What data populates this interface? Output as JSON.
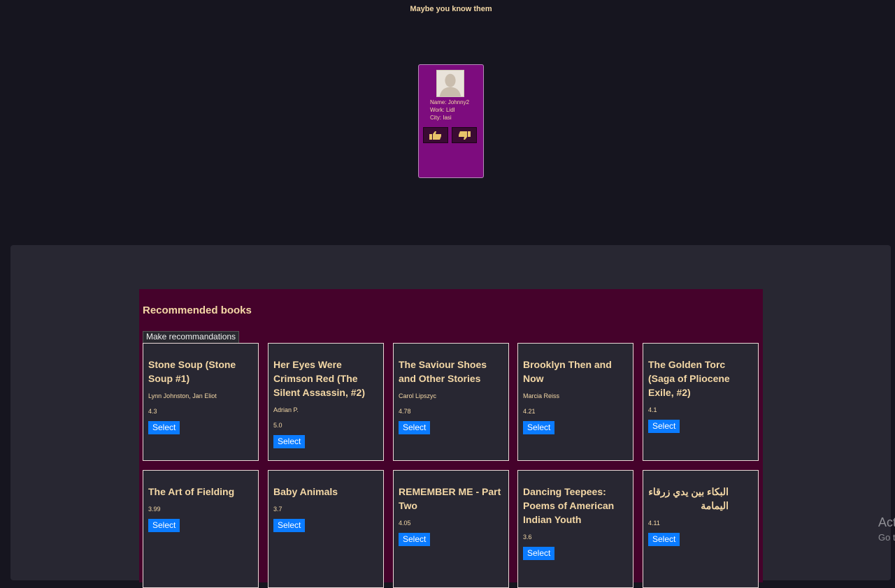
{
  "people_section": {
    "heading": "Maybe you know them",
    "person": {
      "name_line": "Name: Johnny2",
      "work_line": "Work: Lidl",
      "city_line": "City: Iasi",
      "like_icon": "thumbs-up-icon",
      "dislike_icon": "thumbs-down-icon"
    }
  },
  "recommended": {
    "title": "Recommended books",
    "make_button": "Make recommandations",
    "select_label": "Select",
    "books": [
      {
        "title": "Stone Soup (Stone Soup #1)",
        "author": "Lynn Johnston, Jan Eliot",
        "rating": "4.3"
      },
      {
        "title": "Her Eyes Were Crimson Red (The Silent Assassin, #2)",
        "author": "Adrian P.",
        "rating": "5.0"
      },
      {
        "title": "The Saviour Shoes and Other Stories",
        "author": "Carol Lipszyc",
        "rating": "4.78"
      },
      {
        "title": "Brooklyn Then and Now",
        "author": "Marcia Reiss",
        "rating": "4.21"
      },
      {
        "title": "The Golden Torc (Saga of Pliocene Exile, #2)",
        "author": "",
        "rating": "4.1"
      },
      {
        "title": "The Art of Fielding",
        "author": "",
        "rating": "3.99"
      },
      {
        "title": "Baby Animals",
        "author": "",
        "rating": "3.7"
      },
      {
        "title": "REMEMBER ME - Part Two",
        "author": "",
        "rating": "4.05"
      },
      {
        "title": "Dancing Teepees: Poems of American Indian Youth",
        "author": "",
        "rating": "3.6"
      },
      {
        "title": "البكاء بين يدي زرقاء اليمامة",
        "author": "",
        "rating": "4.11"
      }
    ]
  },
  "watermark": {
    "line1": "Act",
    "line2": "Go t"
  },
  "colors": {
    "background": "#16151f",
    "panel": "#282732",
    "rec_box": "#45022b",
    "card": "#7d0c7e",
    "accent_text": "#f4d8a6",
    "button_blue": "#0a7bff"
  }
}
